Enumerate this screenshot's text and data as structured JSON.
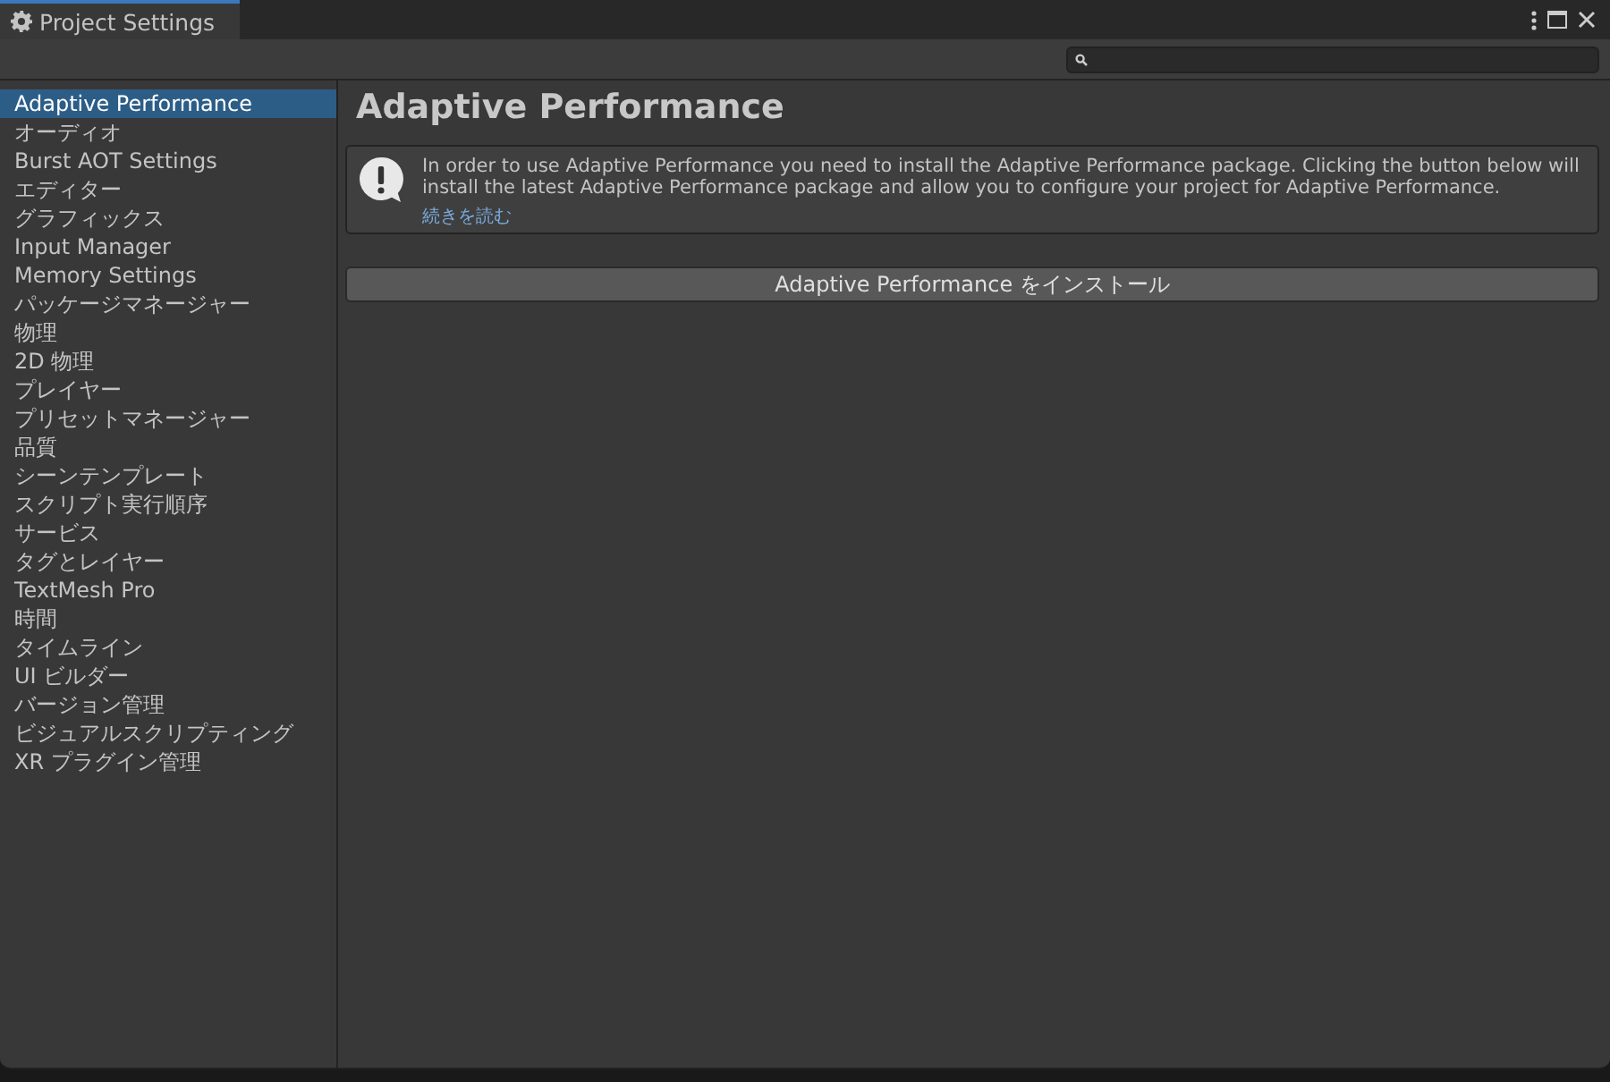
{
  "window": {
    "title": "Project Settings"
  },
  "sidebar": {
    "items": [
      {
        "label": "Adaptive Performance",
        "selected": true
      },
      {
        "label": "オーディオ",
        "selected": false
      },
      {
        "label": "Burst AOT Settings",
        "selected": false
      },
      {
        "label": "エディター",
        "selected": false
      },
      {
        "label": "グラフィックス",
        "selected": false
      },
      {
        "label": "Input Manager",
        "selected": false
      },
      {
        "label": "Memory Settings",
        "selected": false
      },
      {
        "label": "パッケージマネージャー",
        "selected": false
      },
      {
        "label": "物理",
        "selected": false
      },
      {
        "label": "2D 物理",
        "selected": false
      },
      {
        "label": "プレイヤー",
        "selected": false
      },
      {
        "label": "プリセットマネージャー",
        "selected": false
      },
      {
        "label": "品質",
        "selected": false
      },
      {
        "label": "シーンテンプレート",
        "selected": false
      },
      {
        "label": "スクリプト実行順序",
        "selected": false
      },
      {
        "label": "サービス",
        "selected": false
      },
      {
        "label": "タグとレイヤー",
        "selected": false
      },
      {
        "label": "TextMesh Pro",
        "selected": false
      },
      {
        "label": "時間",
        "selected": false
      },
      {
        "label": "タイムライン",
        "selected": false
      },
      {
        "label": "UI ビルダー",
        "selected": false
      },
      {
        "label": "バージョン管理",
        "selected": false
      },
      {
        "label": "ビジュアルスクリプティング",
        "selected": false
      },
      {
        "label": "XR プラグイン管理",
        "selected": false
      }
    ]
  },
  "content": {
    "heading": "Adaptive Performance",
    "notice": {
      "message": "In order to use Adaptive Performance you need to install the Adaptive Performance package. Clicking the button below will install the latest Adaptive Performance package and allow you to configure your project for Adaptive Performance.",
      "link": "続きを読む"
    },
    "install_button": "Adaptive Performance をインストール"
  }
}
